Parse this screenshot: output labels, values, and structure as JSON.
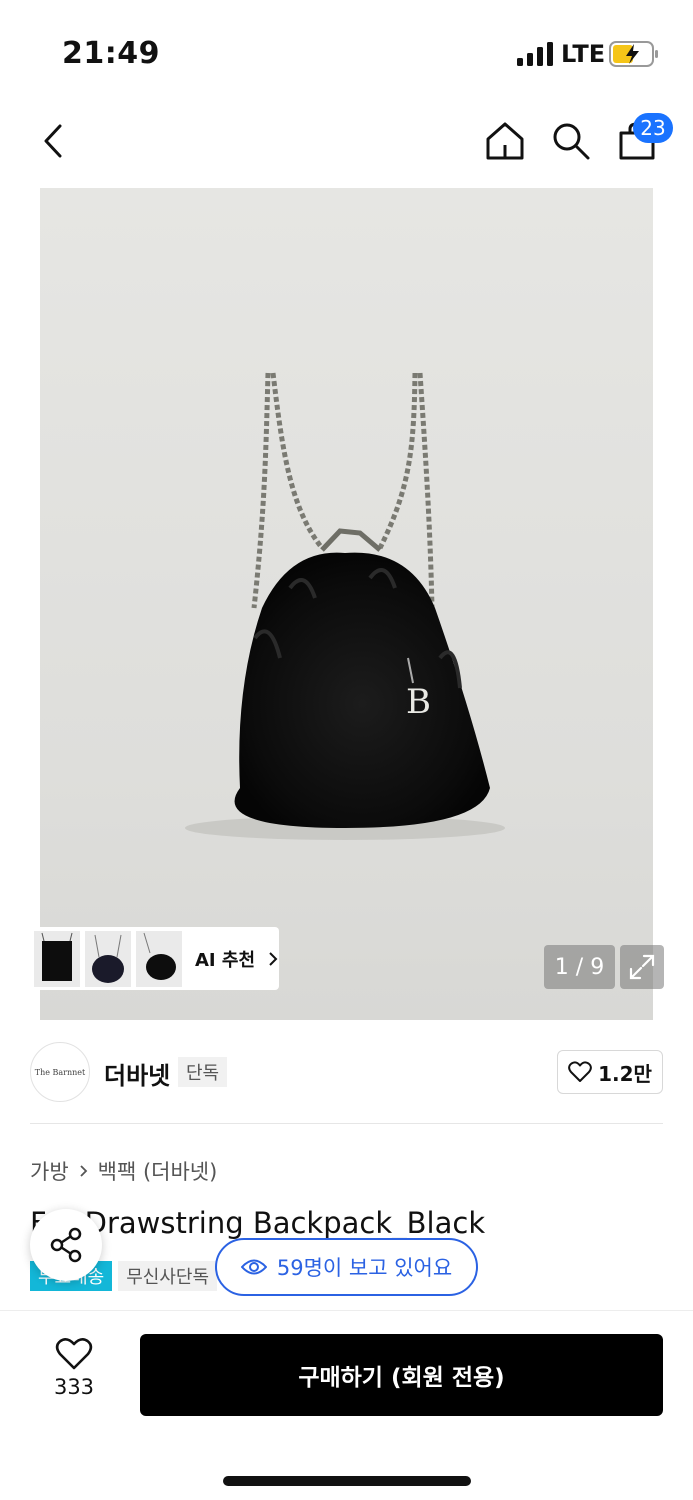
{
  "status_bar": {
    "time": "21:49",
    "network": "LTE",
    "signal_icon": "signal-bars-icon",
    "battery_icon": "battery-charging-icon"
  },
  "nav": {
    "back_icon": "chevron-left-icon",
    "home_icon": "home-icon",
    "search_icon": "search-icon",
    "cart_icon": "shopping-bag-icon",
    "cart_count": "23"
  },
  "gallery": {
    "counter": "1 / 9",
    "ai_label": "AI 추천",
    "expand_icon": "expand-icon"
  },
  "brand": {
    "logo_text": "The Barnnet",
    "name": "더바넷",
    "exclusive": "단독",
    "likes": "1.2만"
  },
  "breadcrumb": {
    "category": "가방",
    "subcategory": "백팩 (더바넷)"
  },
  "product": {
    "title": "Fur Drawstring Backpack_Black",
    "tags": [
      "무료배송",
      "무신사단독"
    ],
    "viewers": "59명이 보고 있어요"
  },
  "bottom": {
    "wish_count": "333",
    "buy_label": "구매하기 (회원 전용)"
  },
  "colors": {
    "accent_blue": "#2b62e3",
    "badge_blue": "#1a73ff",
    "free_shipping": "#13b7d8",
    "buy_button": "#000000"
  }
}
